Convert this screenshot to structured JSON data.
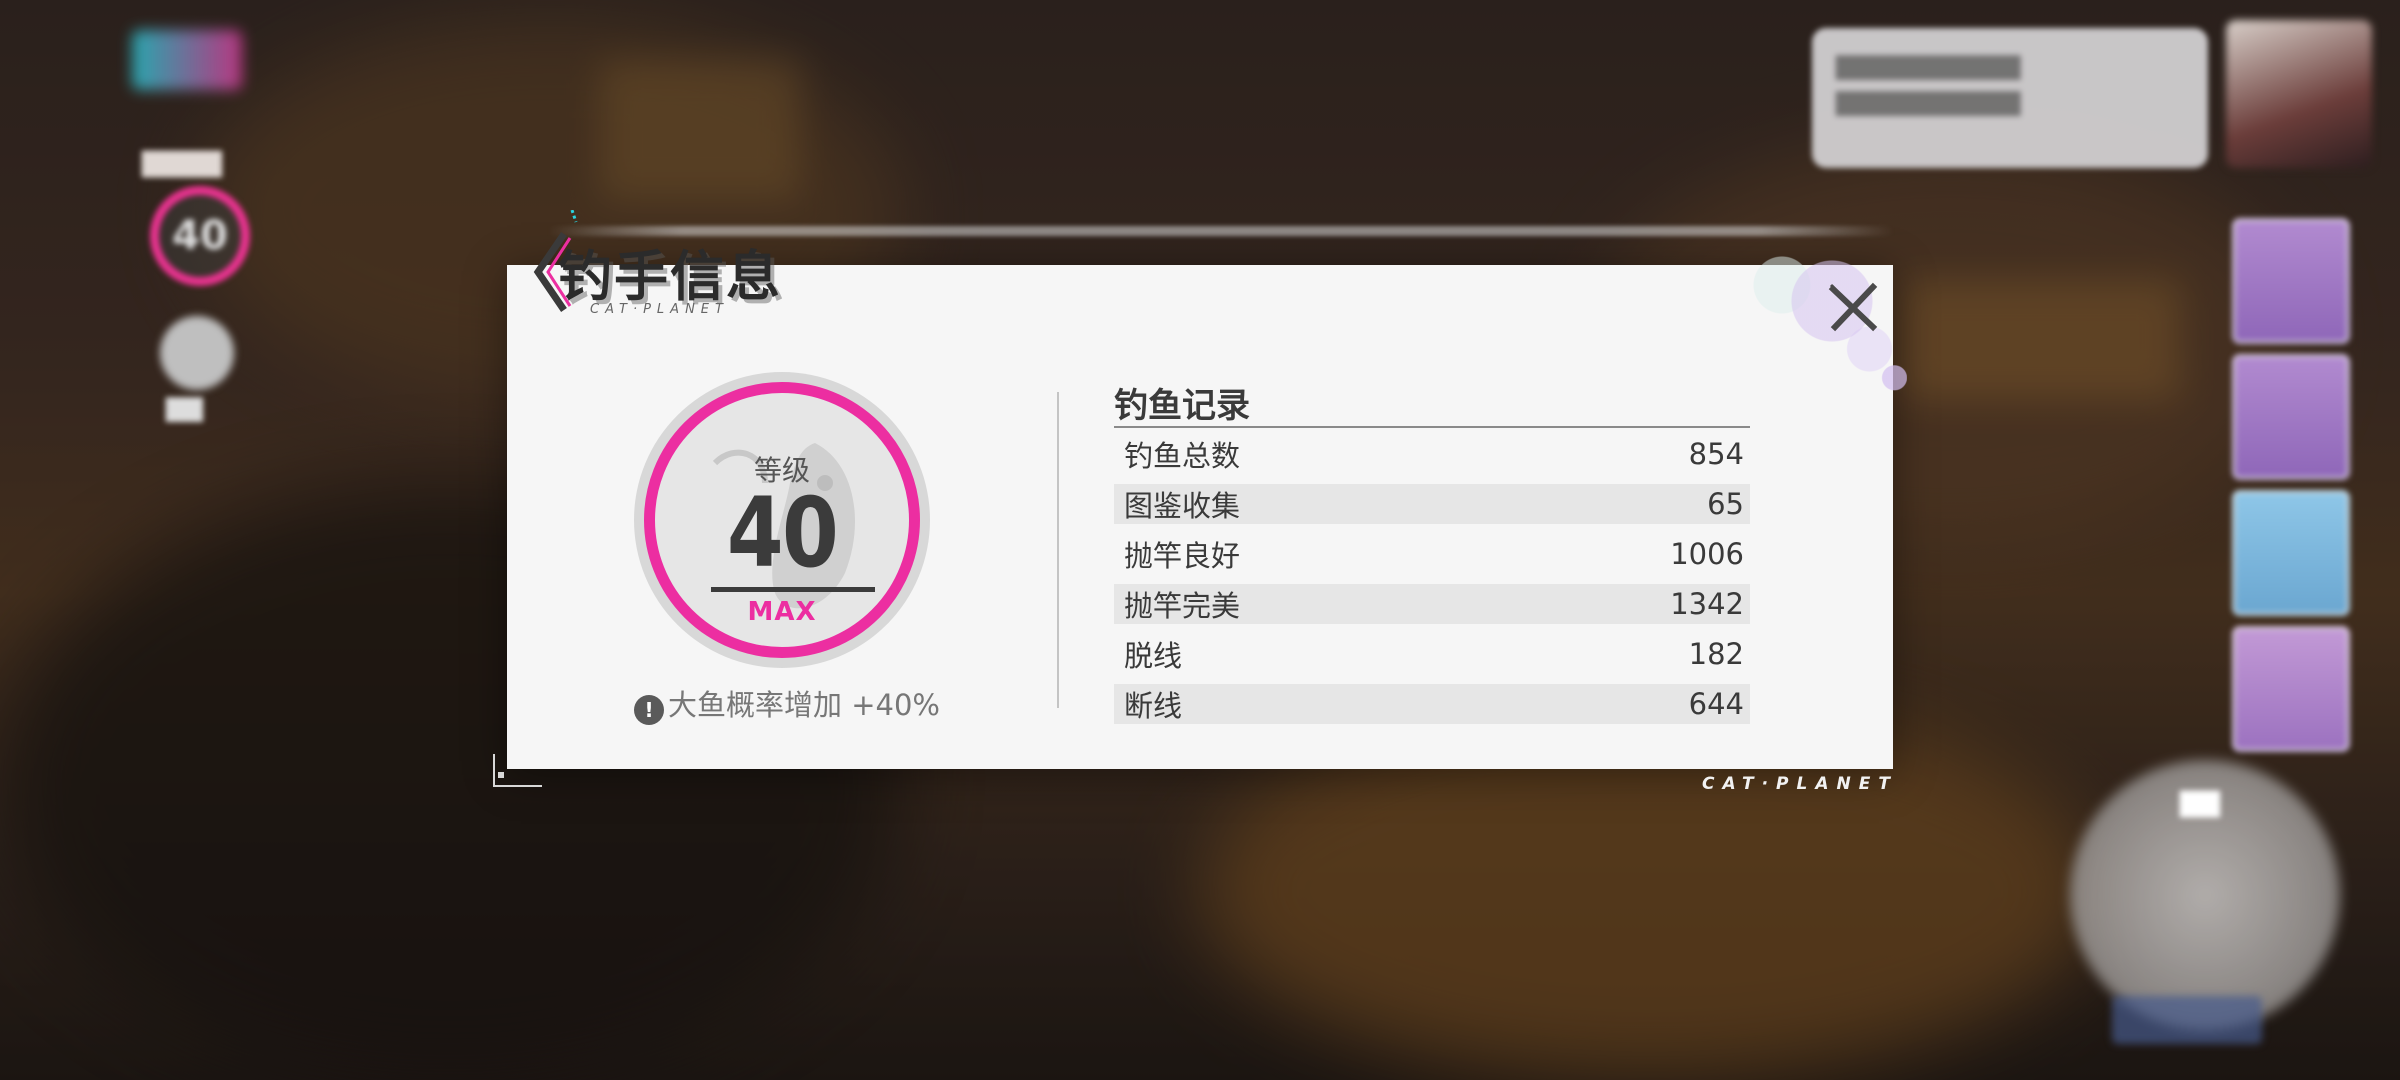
{
  "colors": {
    "accent_pink": "#ec2ea1",
    "panel_bg": "#f6f6f6",
    "text_dark": "#3a3a3a",
    "row_shade": "#e6e6e6"
  },
  "dialog": {
    "title": "钓手信息",
    "subtitle": "CAT·PLANET",
    "close_icon": "close-icon"
  },
  "level": {
    "label": "等级",
    "value": "40",
    "max_label": "MAX",
    "bonus_icon": "exclamation-icon",
    "bonus_text": "大鱼概率增加 +40%"
  },
  "records": {
    "title": "钓鱼记录",
    "rows": [
      {
        "label": "钓鱼总数",
        "value": "854"
      },
      {
        "label": "图鉴收集",
        "value": "65"
      },
      {
        "label": "抛竿良好",
        "value": "1006"
      },
      {
        "label": "抛竿完美",
        "value": "1342"
      },
      {
        "label": "脱线",
        "value": "182"
      },
      {
        "label": "断线",
        "value": "644"
      }
    ]
  },
  "footer": {
    "brand": "CAT·PLANET"
  }
}
